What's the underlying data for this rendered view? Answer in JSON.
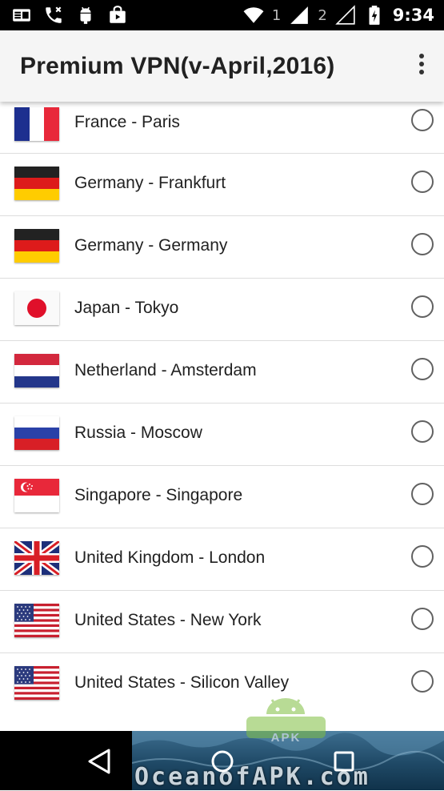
{
  "status_bar": {
    "sim1": "1",
    "sim2": "2",
    "time": "9:34",
    "left_icons": [
      "contact-card-icon",
      "missed-call-icon",
      "android-debug-icon",
      "shopping-bag-icon"
    ],
    "right_icons": [
      "wifi-icon",
      "signal-icon",
      "signal-icon",
      "battery-charging-icon"
    ]
  },
  "app_bar": {
    "title": "Premium VPN(v-April,2016)",
    "menu_icon": "more-vert-icon"
  },
  "servers": [
    {
      "label": "France - Paris",
      "flag": "france-flag",
      "selected": false
    },
    {
      "label": "Germany - Frankfurt",
      "flag": "germany-flag",
      "selected": false
    },
    {
      "label": "Germany - Germany",
      "flag": "germany-flag",
      "selected": false
    },
    {
      "label": "Japan - Tokyo",
      "flag": "japan-flag",
      "selected": false
    },
    {
      "label": "Netherland - Amsterdam",
      "flag": "netherlands-flag",
      "selected": false
    },
    {
      "label": "Russia - Moscow",
      "flag": "russia-flag",
      "selected": false
    },
    {
      "label": "Singapore - Singapore",
      "flag": "singapore-flag",
      "selected": false
    },
    {
      "label": "United Kingdom - London",
      "flag": "uk-flag",
      "selected": false
    },
    {
      "label": "United States - New York",
      "flag": "usa-flag",
      "selected": false
    },
    {
      "label": "United States - Silicon Valley",
      "flag": "usa-flag",
      "selected": false
    }
  ],
  "watermark": {
    "badge": "APK",
    "site": "OceanofAPK.com"
  },
  "nav_bar": {
    "back_icon": "back-triangle-icon",
    "home_icon": "home-circle-icon",
    "recents_icon": "recents-square-icon"
  },
  "colors": {
    "status_bar": "#000000",
    "app_bar": "#f5f5f5",
    "divider": "#dddddd",
    "radio_outline": "#616161"
  }
}
